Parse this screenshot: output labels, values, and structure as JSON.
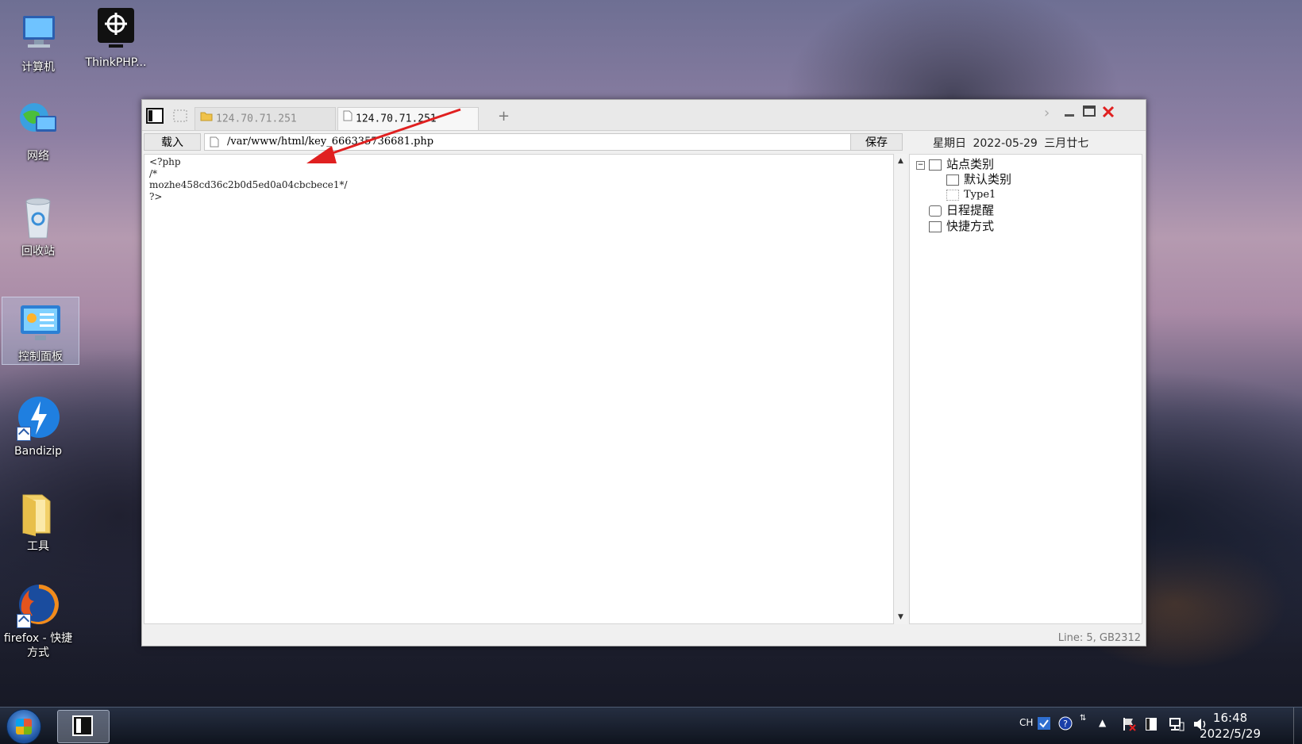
{
  "desktop": {
    "icons": [
      {
        "label": "计算机"
      },
      {
        "label": "ThinkPHP..."
      },
      {
        "label": "网络"
      },
      {
        "label": "回收站"
      },
      {
        "label": "控制面板"
      },
      {
        "label": "Bandizip"
      },
      {
        "label": "工具"
      },
      {
        "label": "firefox - 快捷方式"
      }
    ]
  },
  "window": {
    "tabs": [
      {
        "label": "124.70.71.251",
        "type": "folder",
        "active": false
      },
      {
        "label": "124.70.71.251",
        "type": "file",
        "active": true
      }
    ],
    "new_tab": "+",
    "load_button": "载入",
    "path": "/var/www/html/key_666335736681.php",
    "save_button": "保存",
    "date": {
      "weekday": "星期日",
      "date": "2022-05-29",
      "lunar": "三月廿七"
    },
    "code_lines": [
      "<?php",
      "/*",
      "mozhe458cd36c2b0d5ed0a04cbcbece1*/",
      "?>"
    ],
    "tree": {
      "root": "站点类别",
      "children": [
        "默认类别",
        "Type1"
      ],
      "items": [
        "日程提醒",
        "快捷方式"
      ]
    },
    "status": "Line: 5, GB2312"
  },
  "taskbar": {
    "tray_lang": "CH",
    "time": "16:48",
    "date": "2022/5/29"
  },
  "colors": {
    "accent_red": "#e02020",
    "close_red": "#e02020"
  }
}
